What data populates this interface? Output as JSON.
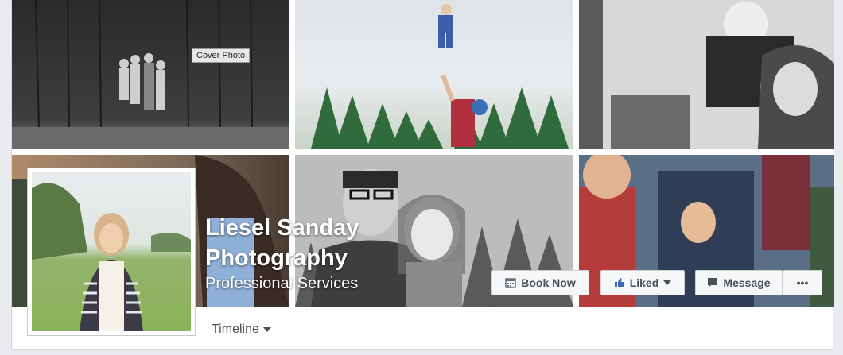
{
  "cover": {
    "tooltip": "Cover Photo",
    "photos": [
      "family-at-barn-photo",
      "child-tossed-in-air-photo",
      "mother-and-child-photo",
      "woman-in-field-photo",
      "father-and-daughter-photo",
      "boys-playing-photo"
    ]
  },
  "page": {
    "name": "Liesel Sanday Photography",
    "category": "Professional Services"
  },
  "actions": {
    "book_now": "Book Now",
    "liked": "Liked",
    "message": "Message",
    "more": "•••"
  },
  "nav": {
    "timeline": "Timeline"
  },
  "icons": {
    "book_now": "calendar-icon",
    "liked": "thumbs-up-icon",
    "message": "chat-bubble-icon",
    "dropdown": "caret-down-icon"
  },
  "colors": {
    "accent_blue": "#4267b2",
    "button_bg": "#f6f7f9",
    "page_bg": "#e9ebee"
  }
}
